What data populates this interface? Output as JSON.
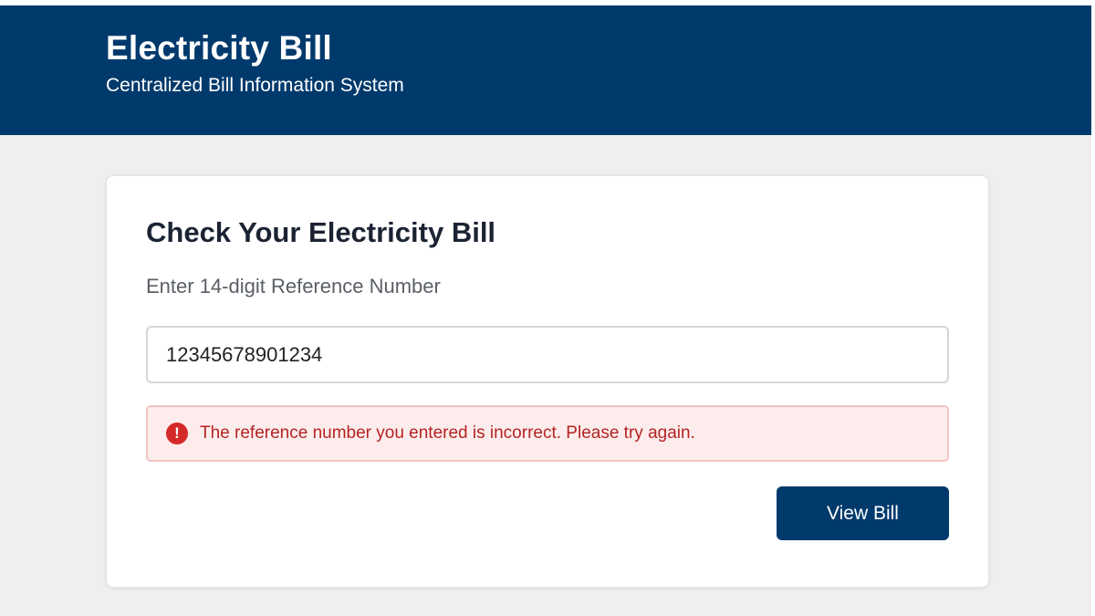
{
  "header": {
    "title": "Electricity Bill",
    "subtitle": "Centralized Bill Information System"
  },
  "card": {
    "title": "Check Your Electricity Bill",
    "field_label": "Enter 14-digit Reference Number",
    "reference_value": "12345678901234",
    "error_message": "The reference number you entered is incorrect. Please try again.",
    "error_icon": "exclamation-circle-icon",
    "error_icon_glyph": "!",
    "submit_label": "View Bill"
  },
  "colors": {
    "brand_navy": "#003a6c",
    "error_red": "#d52a2a",
    "error_bg": "#fdecec"
  }
}
